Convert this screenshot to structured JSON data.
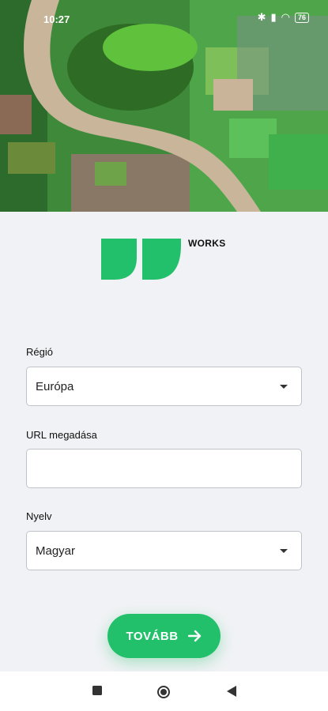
{
  "status_bar": {
    "time": "10:27",
    "battery": "76"
  },
  "brand": {
    "name": "WORKS",
    "color": "#23c06c"
  },
  "form": {
    "region": {
      "label": "Régió",
      "value": "Európa"
    },
    "url": {
      "label": "URL megadása",
      "value": ""
    },
    "language": {
      "label": "Nyelv",
      "value": "Magyar"
    }
  },
  "next_button": {
    "label": "TOVÁBB"
  },
  "nav_bar": {
    "items": [
      "recents-icon",
      "home-icon",
      "back-icon"
    ]
  }
}
